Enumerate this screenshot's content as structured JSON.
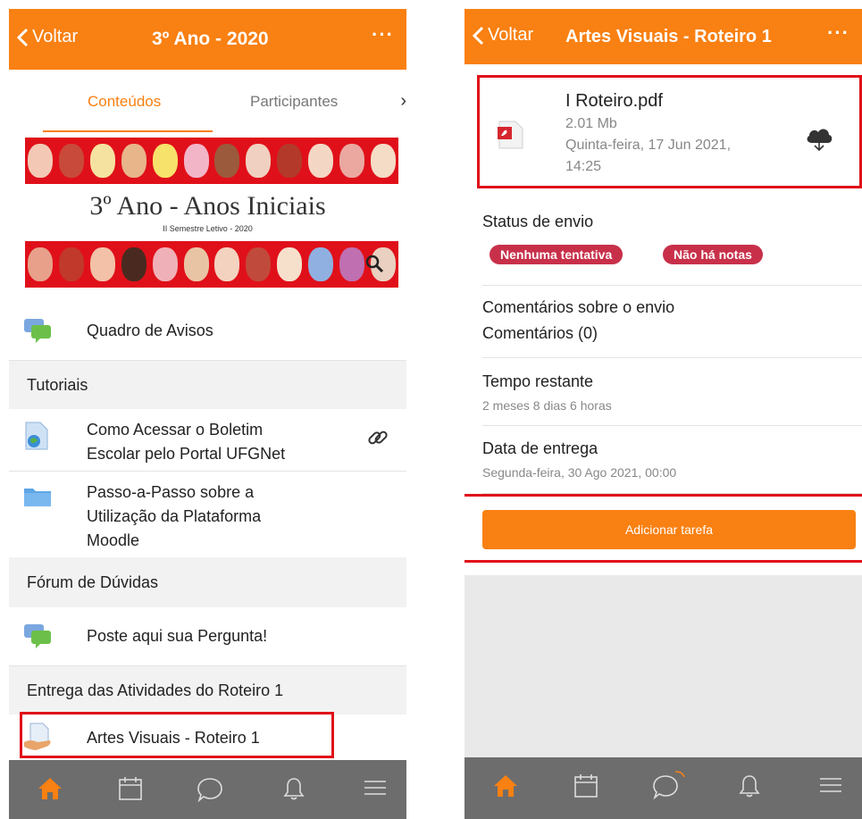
{
  "left": {
    "header": {
      "back_label": "Voltar",
      "title": "3º Ano - 2020",
      "more": "···"
    },
    "tabs": {
      "active": "Conteúdos",
      "second": "Participantes",
      "arrow": "›"
    },
    "banner": {
      "title": "3º Ano - Anos Iniciais",
      "subtitle": "II Semestre Letivo - 2020"
    },
    "items": {
      "avisos": "Quadro de Avisos",
      "section_tutoriais": "Tutoriais",
      "boletim_1": "Como Acessar o Boletim",
      "boletim_2": "Escolar pelo Portal UFGNet",
      "passo_1": "Passo-a-Passo sobre a",
      "passo_2": "Utilização da Plataforma",
      "passo_3": "Moodle",
      "section_forum": "Fórum de Dúvidas",
      "pergunta": "Poste aqui sua Pergunta!",
      "section_entrega": "Entrega das Atividades do Roteiro 1",
      "artes": "Artes Visuais - Roteiro 1"
    }
  },
  "right": {
    "header": {
      "back_label": "Voltar",
      "title": "Artes Visuais - Roteiro 1",
      "more": "···"
    },
    "file": {
      "name": "I Roteiro.pdf",
      "size": "2.01 Mb",
      "date_1": "Quinta-feira, 17 Jun 2021,",
      "date_2": "14:25"
    },
    "status": {
      "label": "Status de envio",
      "badge_1": "Nenhuma tentativa",
      "badge_2": "Não há notas"
    },
    "comments": {
      "label": "Comentários sobre o envio",
      "value": "Comentários (0)"
    },
    "time": {
      "label": "Tempo restante",
      "value": "2 meses 8 dias 6 horas"
    },
    "due": {
      "label": "Data de entrega",
      "value": "Segunda-feira, 30 Ago 2021, 00:00"
    },
    "button": "Adicionar tarefa"
  },
  "colors": {
    "accent": "#f98012",
    "highlight": "#e0101a",
    "badge": "#c8304a",
    "bottom_bar": "#6d6d6d"
  },
  "icons": [
    "chevron-left-icon",
    "more-icon",
    "chevron-right-icon",
    "chat-icon",
    "url-icon",
    "link-icon",
    "folder-icon",
    "assign-icon",
    "pdf-icon",
    "cloud-download-icon",
    "home-icon",
    "calendar-icon",
    "messages-icon",
    "bell-icon",
    "menu-icon"
  ]
}
